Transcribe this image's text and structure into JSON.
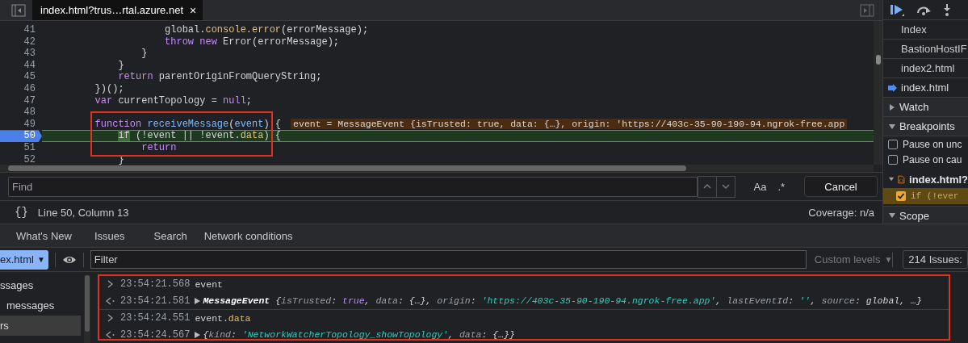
{
  "editor_tab": {
    "title": "index.html?trus…rtal.azure.net",
    "close": "×"
  },
  "code_lines": [
    {
      "number": "41",
      "current": false,
      "segments": [
        {
          "text": "                    global.",
          "kind": "plain"
        },
        {
          "text": "console",
          "kind": "prop"
        },
        {
          "text": ".",
          "kind": "plain"
        },
        {
          "text": "error",
          "kind": "prop"
        },
        {
          "text": "(errorMessage);",
          "kind": "plain"
        }
      ]
    },
    {
      "number": "42",
      "current": false,
      "segments": [
        {
          "text": "                    throw new",
          "kind": "keyword"
        },
        {
          "text": " Error(errorMessage);",
          "kind": "plain"
        }
      ]
    },
    {
      "number": "43",
      "current": false,
      "segments": [
        {
          "text": "                }",
          "kind": "plain"
        }
      ]
    },
    {
      "number": "44",
      "current": false,
      "segments": [
        {
          "text": "            }",
          "kind": "plain"
        }
      ]
    },
    {
      "number": "45",
      "current": false,
      "segments": [
        {
          "text": "            return",
          "kind": "keyword"
        },
        {
          "text": " parentOriginFromQueryString;",
          "kind": "plain"
        }
      ]
    },
    {
      "number": "46",
      "current": false,
      "segments": [
        {
          "text": "        })();",
          "kind": "plain"
        }
      ]
    },
    {
      "number": "47",
      "current": false,
      "segments": [
        {
          "text": "        var",
          "kind": "keyword"
        },
        {
          "text": " currentTopology = ",
          "kind": "plain"
        },
        {
          "text": "null",
          "kind": "keyword"
        },
        {
          "text": ";",
          "kind": "plain"
        }
      ]
    },
    {
      "number": "48",
      "current": false
    },
    {
      "number": "49",
      "current": false,
      "segments": [
        {
          "text": "        function ",
          "kind": "keyword"
        },
        {
          "text": "receiveMessage",
          "kind": "def"
        },
        {
          "text": "(",
          "kind": "plain"
        },
        {
          "text": "event",
          "kind": "def"
        },
        {
          "text": ") {",
          "kind": "plain"
        }
      ],
      "inline_value": "event = MessageEvent {isTrusted: true, data: {…}, origin: 'https://403c-35-90-190-94.ngrok-free.app"
    },
    {
      "number": "50",
      "current": true,
      "segments": [
        {
          "text": "            if",
          "kind": "exec"
        },
        {
          "text": " (!event || !event.",
          "kind": "plain"
        },
        {
          "text": "data",
          "kind": "prop"
        },
        {
          "text": ") {",
          "kind": "plain"
        }
      ]
    },
    {
      "number": "51",
      "current": false,
      "segments": [
        {
          "text": "                return",
          "kind": "keyword"
        }
      ]
    },
    {
      "number": "52",
      "current": false,
      "segments": [
        {
          "text": "            }",
          "kind": "plain"
        }
      ]
    }
  ],
  "find_bar": {
    "placeholder": "Find",
    "case_button": "Aa",
    "regex_button": ".*",
    "cancel": "Cancel"
  },
  "status_bar": {
    "pretty_print": "{}",
    "position": "Line 50, Column 13",
    "coverage": "Coverage: n/a"
  },
  "debugger_sidebar": {
    "files": [
      {
        "label": "Index",
        "selected": false
      },
      {
        "label": "BastionHostIF",
        "selected": false
      },
      {
        "label": "index2.html",
        "selected": false
      },
      {
        "label": "index.html",
        "selected": true
      }
    ],
    "sections": [
      {
        "label": "Watch",
        "expanded": false
      },
      {
        "label": "Breakpoints",
        "expanded": true
      },
      {
        "label": "Scope",
        "expanded": true
      }
    ],
    "pause_options": [
      {
        "label": "Pause on unc",
        "checked": false
      },
      {
        "label": "Pause on cau",
        "checked": false
      }
    ],
    "breakpoint_file": {
      "label": "index.html?",
      "expanded": true
    },
    "breakpoints": [
      {
        "code": "if (!ever",
        "checked": true
      }
    ]
  },
  "drawer_tabs": [
    {
      "label": "What's New",
      "selected": false
    },
    {
      "label": "Issues",
      "selected": false
    },
    {
      "label": "Search",
      "selected": false
    },
    {
      "label": "Network conditions",
      "selected": false
    }
  ],
  "console_toolbar": {
    "context": "ex.html",
    "context_caret": "▼",
    "filter_placeholder": "Filter",
    "levels": "Custom levels",
    "levels_caret": "▼",
    "issues": "214 Issues:"
  },
  "console_sidebar": [
    {
      "label": "ssages",
      "selected": false
    },
    {
      "label": "messages",
      "selected": false
    },
    {
      "label": "rs",
      "selected": true
    }
  ],
  "console_entries": [
    {
      "kind": "input",
      "time": "23:54:21.568",
      "expandable": false,
      "segments": [
        {
          "text": "event",
          "kind": "plain"
        }
      ]
    },
    {
      "kind": "output",
      "time": "23:54:21.581",
      "expandable": true,
      "segments": [
        {
          "text": "MessageEvent ",
          "kind": "name"
        },
        {
          "text": "{",
          "kind": "value"
        },
        {
          "text": "isTrusted",
          "kind": "key"
        },
        {
          "text": ": ",
          "kind": "value"
        },
        {
          "text": "true",
          "kind": "bool"
        },
        {
          "text": ", ",
          "kind": "value"
        },
        {
          "text": "data",
          "kind": "key"
        },
        {
          "text": ": {…}, ",
          "kind": "value"
        },
        {
          "text": "origin",
          "kind": "key"
        },
        {
          "text": ": ",
          "kind": "value"
        },
        {
          "text": "'https://403c-35-90-190-94.ngrok-free.app'",
          "kind": "string"
        },
        {
          "text": ", ",
          "kind": "value"
        },
        {
          "text": "lastEventId",
          "kind": "key"
        },
        {
          "text": ": ",
          "kind": "value"
        },
        {
          "text": "''",
          "kind": "string"
        },
        {
          "text": ", ",
          "kind": "value"
        },
        {
          "text": "source",
          "kind": "key"
        },
        {
          "text": ": global, …}",
          "kind": "value"
        }
      ]
    },
    {
      "kind": "input",
      "time": "23:54:24.551",
      "expandable": false,
      "segments": [
        {
          "text": "event.",
          "kind": "plain"
        },
        {
          "text": "data",
          "kind": "prop"
        }
      ]
    },
    {
      "kind": "output",
      "time": "23:54:24.567",
      "expandable": true,
      "segments": [
        {
          "text": "{",
          "kind": "value"
        },
        {
          "text": "kind",
          "kind": "key"
        },
        {
          "text": ": ",
          "kind": "value"
        },
        {
          "text": "'NetworkWatcherTopology_showTopology'",
          "kind": "string"
        },
        {
          "text": ", ",
          "kind": "value"
        },
        {
          "text": "data",
          "kind": "key"
        },
        {
          "text": ": {…}}",
          "kind": "value"
        }
      ]
    }
  ]
}
